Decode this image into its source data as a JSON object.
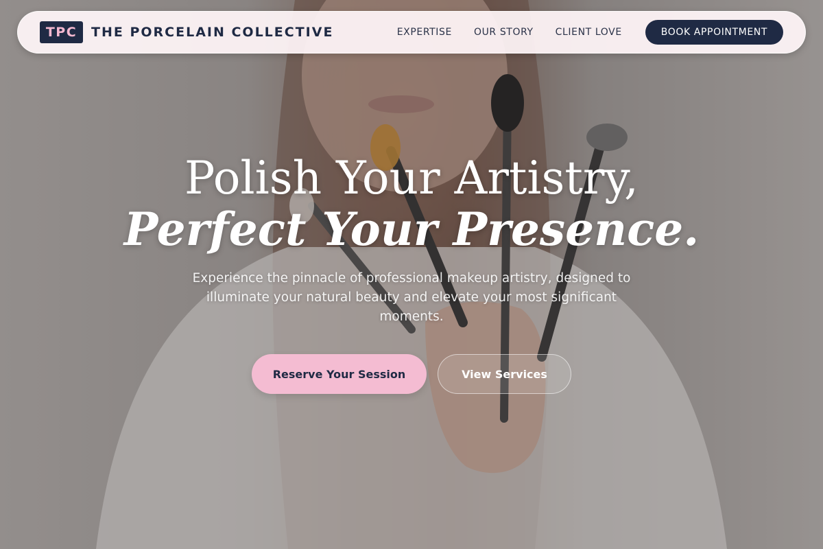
{
  "brand": {
    "badge": "TPC",
    "name": "THE PORCELAIN COLLECTIVE"
  },
  "nav": {
    "links": [
      "EXPERTISE",
      "OUR STORY",
      "CLIENT LOVE"
    ],
    "cta": "BOOK APPOINTMENT"
  },
  "hero": {
    "headline_line1": "Polish Your Artistry,",
    "headline_line2": "Perfect Your Presence.",
    "subtitle": "Experience the pinnacle of professional makeup artistry, designed to illuminate your natural beauty and elevate your most significant moments.",
    "primary_button": "Reserve Your Session",
    "secondary_button": "View Services",
    "background_image": "makeup-artist-holding-brushes"
  },
  "colors": {
    "navy": "#1f2a44",
    "pink": "#f4bcd2",
    "nav_bg": "#fff5f8"
  }
}
